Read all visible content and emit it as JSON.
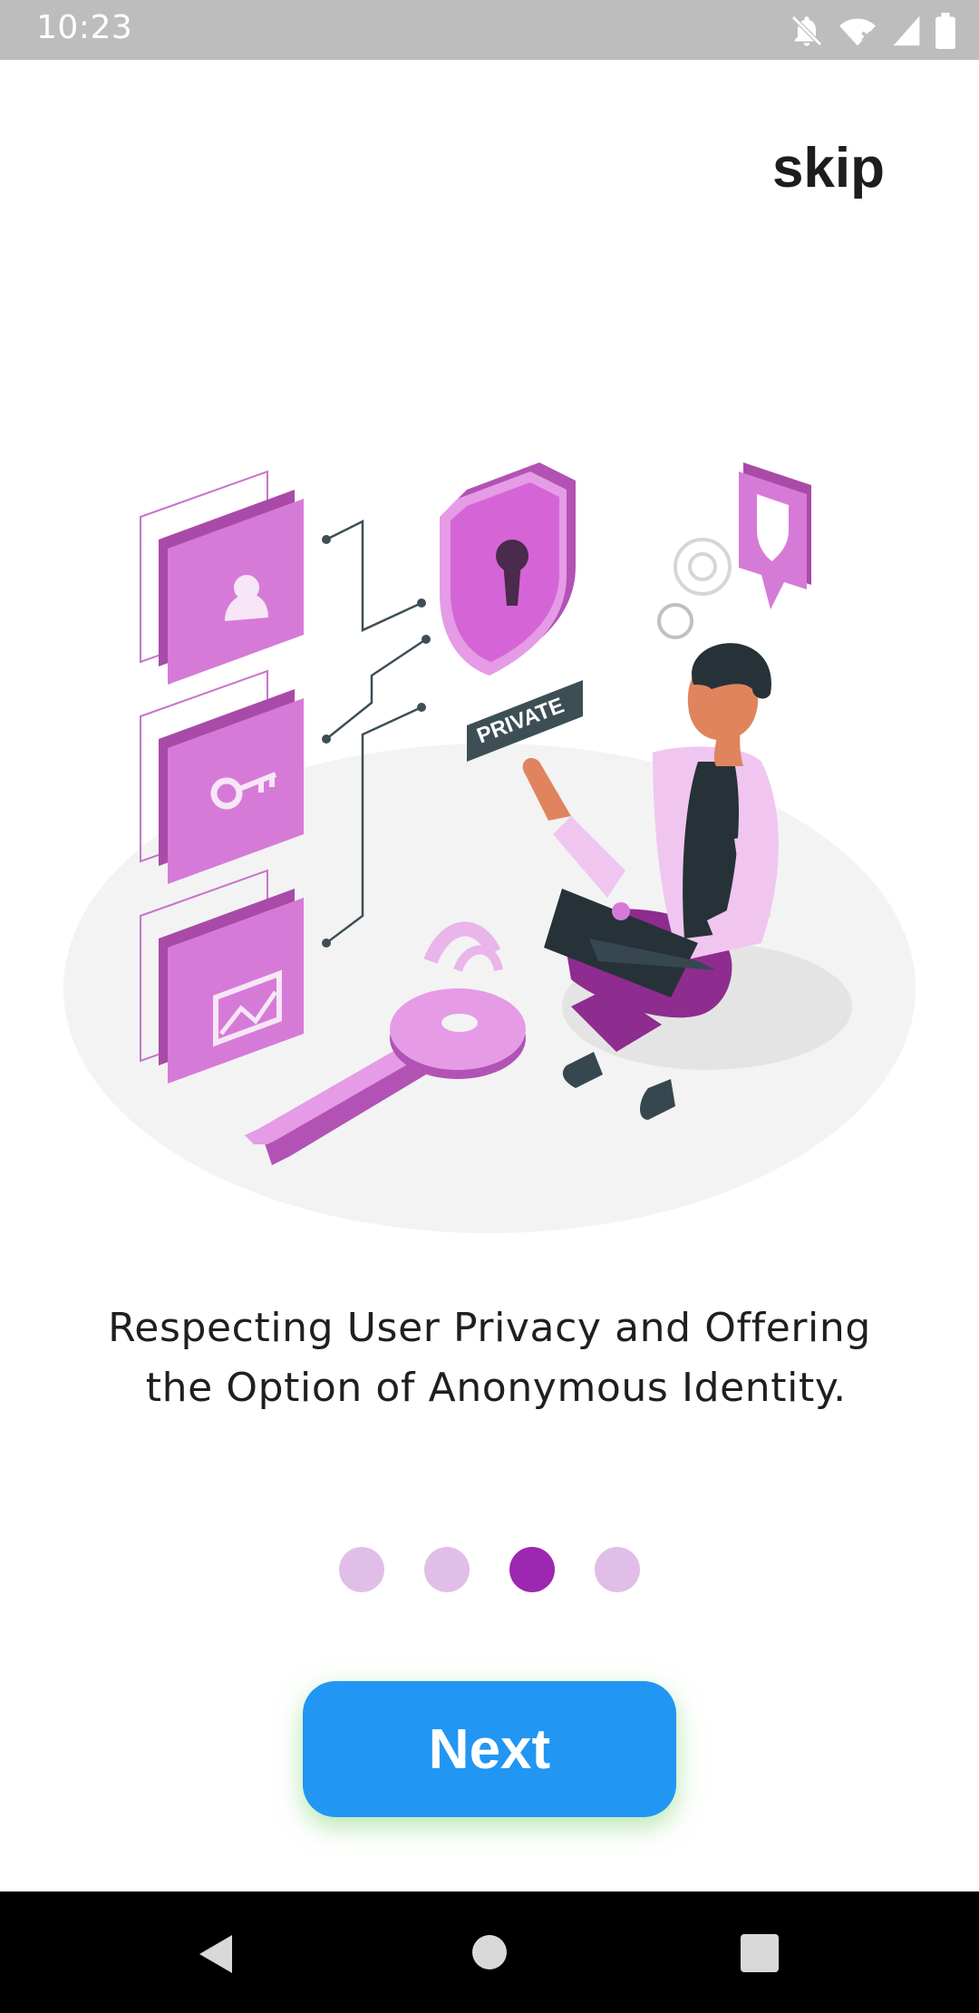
{
  "status_bar": {
    "time": "10:23",
    "icons": [
      "notifications-off-icon",
      "wifi-icon",
      "signal-icon",
      "battery-icon"
    ]
  },
  "header": {
    "skip_label": "skip"
  },
  "illustration": {
    "name": "privacy-illustration",
    "private_label": "PRIVATE"
  },
  "content": {
    "message_line1": "Respecting User Privacy and Offering",
    "message_line2": " the Option of Anonymous Identity."
  },
  "pagination": {
    "total": 4,
    "active_index": 2,
    "active_color": "#9c27b0",
    "inactive_color": "#e1bee7"
  },
  "actions": {
    "next_label": "Next",
    "next_color": "#2196f3"
  },
  "nav_bar": {
    "buttons": [
      "back-icon",
      "home-icon",
      "recents-icon"
    ]
  }
}
